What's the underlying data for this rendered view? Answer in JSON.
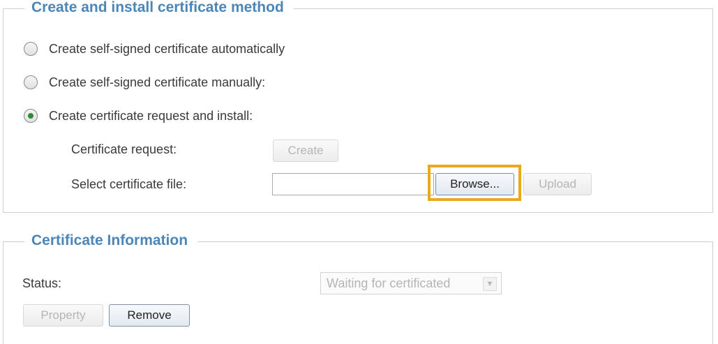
{
  "method_section": {
    "legend": "Create and install certificate method",
    "options": [
      {
        "label": "Create self-signed certificate automatically",
        "checked": false
      },
      {
        "label": "Create self-signed certificate manually:",
        "checked": false
      },
      {
        "label": "Create certificate request and install:",
        "checked": true
      }
    ],
    "certificate_request_label": "Certificate request:",
    "create_button": "Create",
    "select_file_label": "Select certificate file:",
    "file_value": "",
    "browse_button": "Browse...",
    "upload_button": "Upload",
    "highlight_color": "#e8a820"
  },
  "info_section": {
    "legend": "Certificate Information",
    "status_label": "Status:",
    "status_value": "Waiting for certificated",
    "property_button": "Property",
    "remove_button": "Remove"
  },
  "colors": {
    "legend": "#4a86b8",
    "radio_checked": "#2f8a3a"
  },
  "icons": {
    "dropdown": "chevron-down-icon"
  }
}
